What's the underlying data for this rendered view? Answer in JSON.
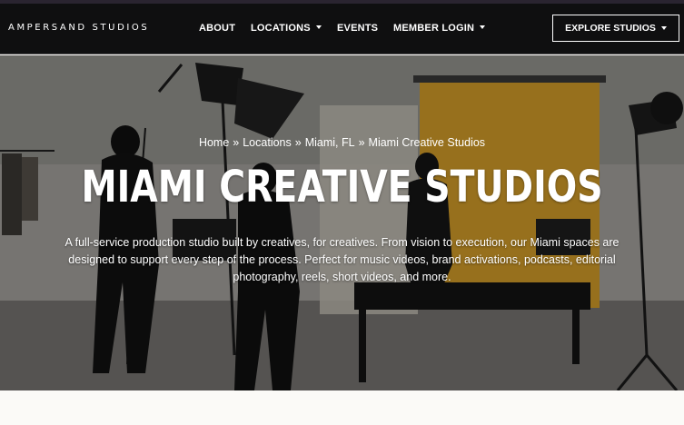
{
  "brand": {
    "logo_text": "AMPERSAND STUDIOS"
  },
  "nav": {
    "items": [
      {
        "label": "ABOUT",
        "has_dropdown": false
      },
      {
        "label": "LOCATIONS",
        "has_dropdown": true
      },
      {
        "label": "EVENTS",
        "has_dropdown": false
      },
      {
        "label": "MEMBER LOGIN",
        "has_dropdown": true
      }
    ],
    "cta": {
      "label": "EXPLORE STUDIOS",
      "has_dropdown": true
    }
  },
  "hero": {
    "breadcrumb": {
      "home": "Home",
      "locations": "Locations",
      "city": "Miami, FL",
      "current": "Miami Creative Studios",
      "separator": "»"
    },
    "title": "MIAMI CREATIVE STUDIOS",
    "description": "A full-service production studio built by creatives, for creatives. From vision to execution, our Miami spaces are designed to support every step of the process. Perfect for music videos, brand activations, podcasts, editorial photography, reels, short videos, and more."
  },
  "colors": {
    "header_bg": "#0f0f10",
    "text": "#ffffff",
    "backdrop_yellow": "#d9a12a",
    "page_bg": "#fbfaf7"
  }
}
